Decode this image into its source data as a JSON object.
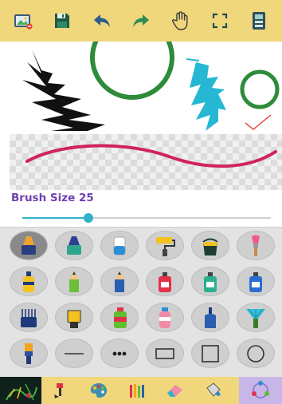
{
  "toolbar": {
    "icons": [
      "image-icon",
      "save-icon",
      "undo-icon",
      "redo-icon",
      "hand-icon",
      "fullscreen-icon",
      "layers-icon"
    ]
  },
  "brush": {
    "label": "Brush Size 25",
    "size_fraction": 0.28
  },
  "tools": [
    [
      "crayon-navy",
      "crayon-teal",
      "marker-blue",
      "paint-roller",
      "paint-bucket",
      "brush-pink"
    ],
    [
      "marker-yellow",
      "pencil-green",
      "pencil-blue",
      "bottle-red",
      "bottle-teal",
      "bottle-blue"
    ],
    [
      "comb-brush",
      "glove",
      "spray-green",
      "spray-pink",
      "bottle-navy",
      "fan-brush"
    ],
    [
      "brush-tip",
      "line",
      "dotted-line",
      "rectangle",
      "square",
      "circle"
    ]
  ],
  "bottom": {
    "icons": [
      "artwork-thumbnail",
      "paintbrush-icon",
      "palette-icon",
      "pencils-icon",
      "eraser-icon",
      "fill-icon",
      "color-wheel-icon"
    ]
  },
  "colors": {
    "toolbar_bg": "#f0d77c",
    "accent": "#2fb3c9",
    "label": "#6f3fb0",
    "stroke": "#d0245a"
  }
}
